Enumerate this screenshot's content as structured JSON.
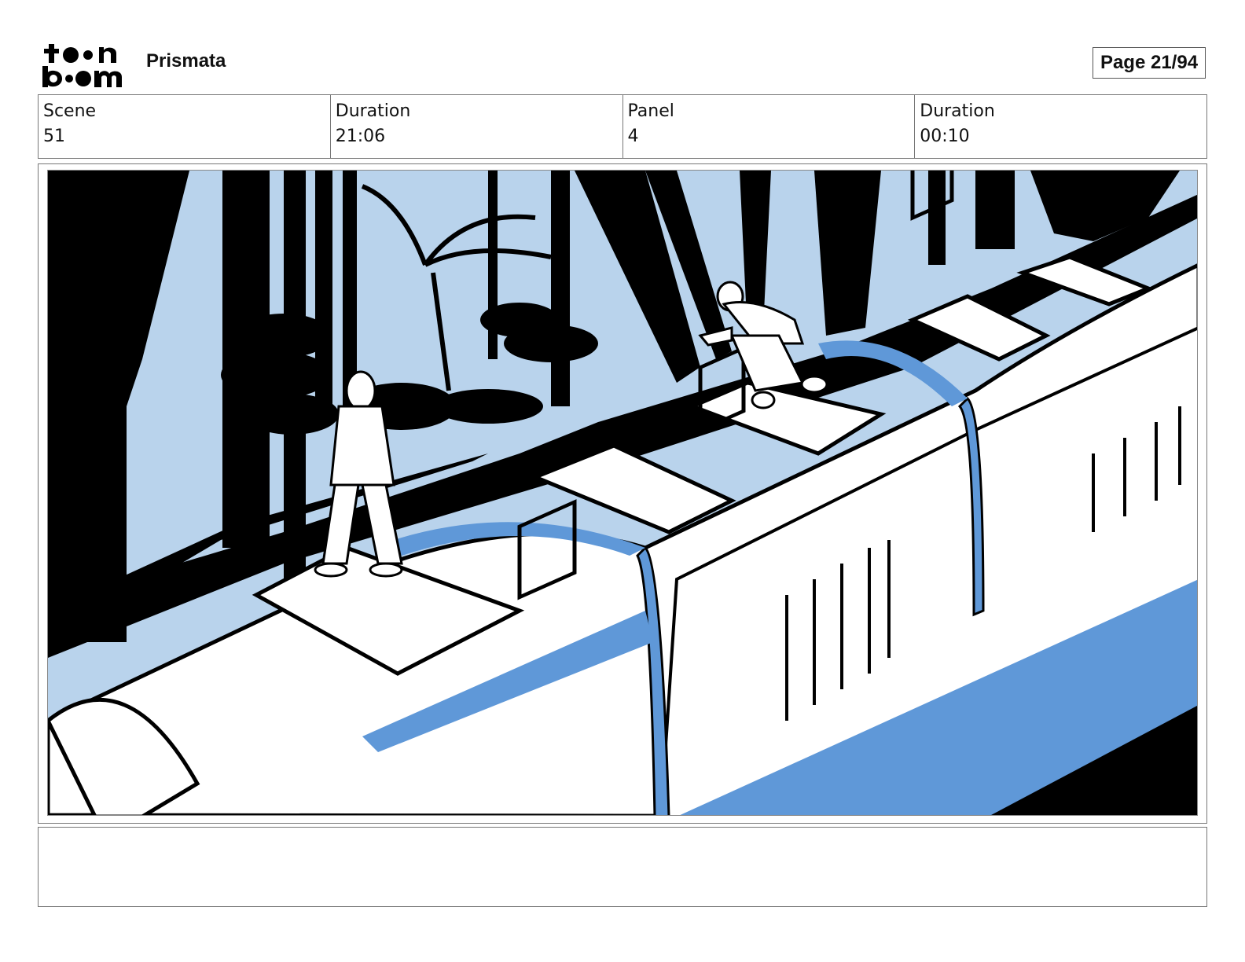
{
  "header": {
    "logo_text": "toon boom",
    "project_title": "Prismata",
    "page_label": "Page 21/94"
  },
  "info": {
    "cells": [
      {
        "label": "Scene",
        "value": "51"
      },
      {
        "label": "Duration",
        "value": "21:06"
      },
      {
        "label": "Panel",
        "value": "4"
      },
      {
        "label": "Duration",
        "value": "00:10"
      }
    ]
  },
  "panel": {
    "colors": {
      "sky": "#b9d3ec",
      "accent": "#5f98d8",
      "ink": "#000000",
      "paper": "#ffffff"
    }
  },
  "notes": {
    "text": ""
  }
}
